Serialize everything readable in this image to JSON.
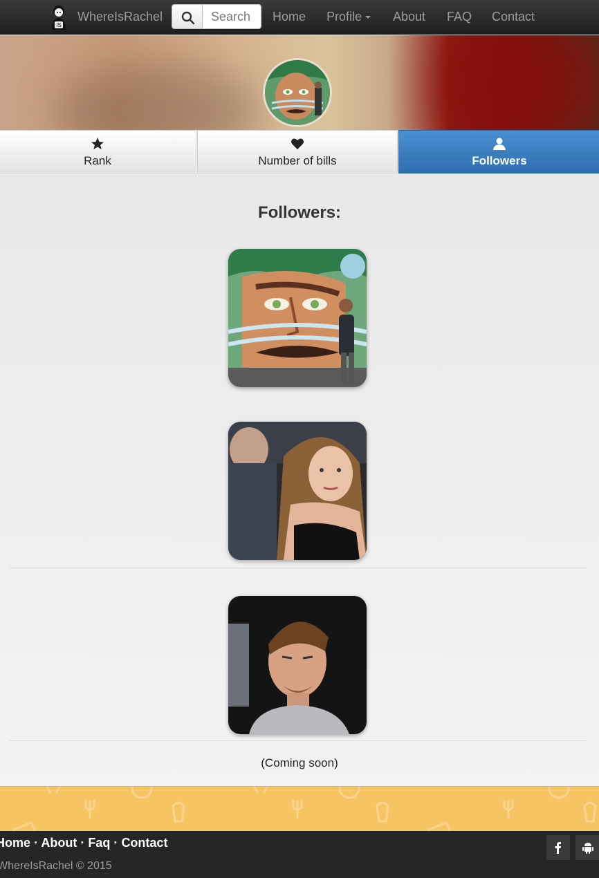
{
  "navbar": {
    "brand": "WhereIsRachel",
    "search_placeholder": "Search",
    "links": {
      "home": "Home",
      "profile": "Profile",
      "about": "About",
      "faq": "FAQ",
      "contact": "Contact"
    }
  },
  "tabs": [
    {
      "label": "Rank",
      "icon": "star-icon",
      "active": false
    },
    {
      "label": "Number of bills",
      "icon": "heart-icon",
      "active": false
    },
    {
      "label": "Followers",
      "icon": "user-icon",
      "active": true
    }
  ],
  "main": {
    "title": "Followers:",
    "followers_count_shown": 3,
    "coming_soon": "(Coming soon)"
  },
  "footer": {
    "links": [
      "Home",
      "About",
      "Faq",
      "Contact"
    ],
    "separator": "·",
    "copyright": "WhereIsRachel © 2015",
    "social_icons": [
      "facebook-icon",
      "android-icon"
    ]
  },
  "colors": {
    "navbar_bg": "#262626",
    "active_tab": "#337ab7",
    "strip": "#f7c464",
    "footer_bg": "#262626"
  }
}
